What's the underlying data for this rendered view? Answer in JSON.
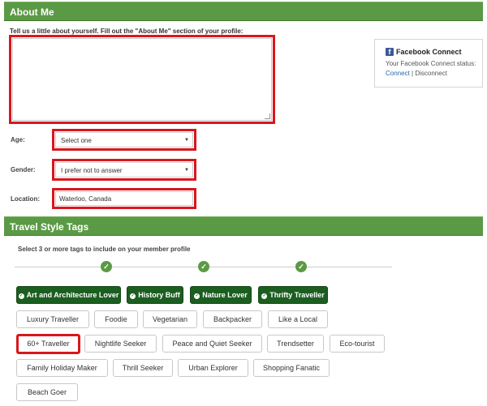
{
  "about_section": {
    "title": "About Me",
    "instruction": "Tell us a little about yourself. Fill out the \"About Me\" section of your profile:",
    "about_text": ""
  },
  "fields": {
    "age": {
      "label": "Age:",
      "value": "Select one"
    },
    "gender": {
      "label": "Gender:",
      "value": "I prefer not to answer"
    },
    "location": {
      "label": "Location:",
      "value": "Waterloo, Canada"
    }
  },
  "facebook": {
    "title": "Facebook Connect",
    "status_text": "Your Facebook Connect status:",
    "connect_label": "Connect",
    "separator": "|",
    "disconnect_label": "Disconnect",
    "logo_letter": "f"
  },
  "travel_section": {
    "title": "Travel Style Tags",
    "instruction": "Select 3 or more tags to include on your member profile",
    "progress_steps": 3,
    "selected_tags": [
      "Art and Architecture Lover",
      "History Buff",
      "Nature Lover",
      "Thrifty Traveller"
    ],
    "tags": [
      "Luxury Traveller",
      "Foodie",
      "Vegetarian",
      "Backpacker",
      "Like a Local",
      "60+ Traveller",
      "Nightlife Seeker",
      "Peace and Quiet Seeker",
      "Trendsetter",
      "Eco-tourist",
      "Family Holiday Maker",
      "Thrill Seeker",
      "Urban Explorer",
      "Shopping Fanatic",
      "Beach Goer"
    ]
  },
  "colors": {
    "section_bar": "#5b9a45",
    "selected_tag": "#1b5e20",
    "highlight": "#d8171d",
    "link": "#2465a6"
  }
}
